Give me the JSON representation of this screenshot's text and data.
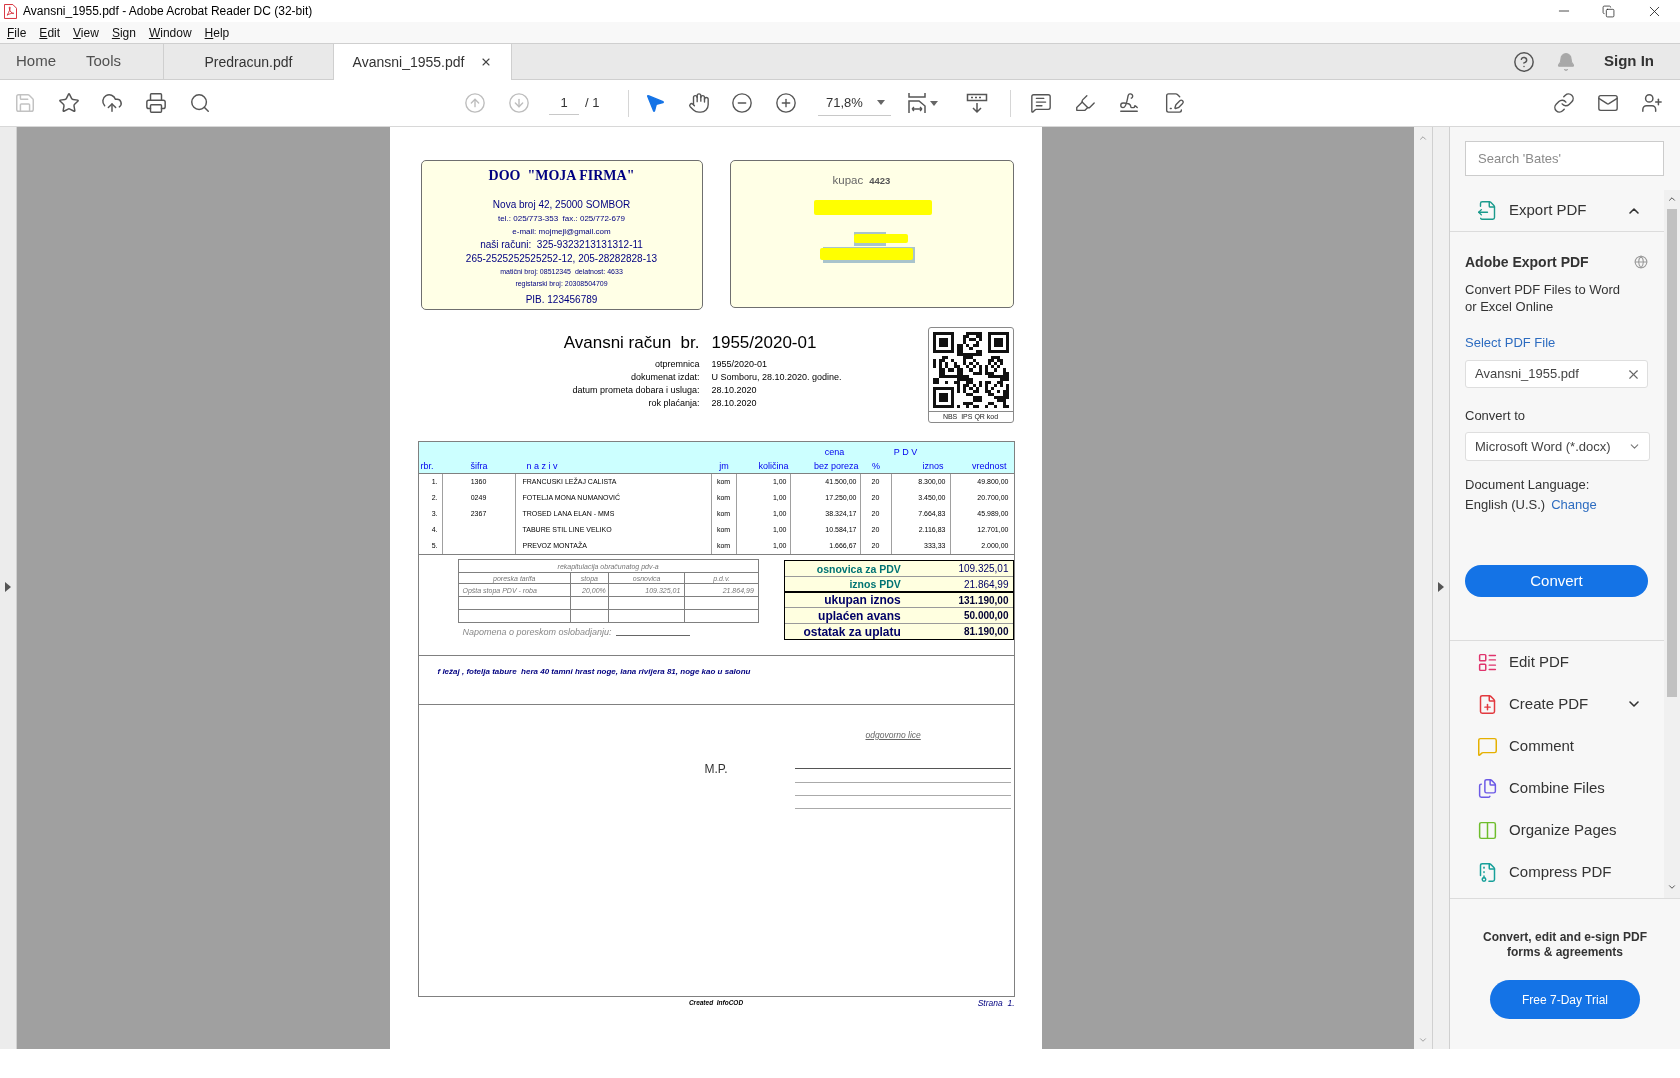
{
  "window": {
    "title": "Avansni_1955.pdf - Adobe Acrobat Reader DC (32-bit)"
  },
  "menu": [
    "File",
    "Edit",
    "View",
    "Sign",
    "Window",
    "Help"
  ],
  "nav": [
    "Home",
    "Tools"
  ],
  "tabs": [
    {
      "label": "Predracun.pdf",
      "selected": false
    },
    {
      "label": "Avansni_1955.pdf",
      "selected": true
    }
  ],
  "account": {
    "sign_in": "Sign In"
  },
  "toolbar": {
    "file_tools": [
      {
        "kind": "save",
        "disabled": true
      },
      {
        "kind": "bookmark",
        "disabled": false
      },
      {
        "kind": "upload",
        "disabled": false
      },
      {
        "kind": "print",
        "disabled": false
      },
      {
        "kind": "find",
        "disabled": false
      }
    ],
    "page_nav": [
      {
        "kind": "previous",
        "disabled": true
      },
      {
        "kind": "next",
        "disabled": true
      }
    ],
    "page": "1",
    "page_count": "/ 1",
    "pointer_tools": [
      {
        "kind": "select",
        "selected": true
      },
      {
        "kind": "hand",
        "selected": false
      }
    ],
    "zoom": "71,8%"
  },
  "document": {
    "seller": {
      "name": "DOO  \"MOJA FIRMA\"",
      "lines": [
        {
          "text": "Nova broj 42, 25000 SOMBOR",
          "kind": "large"
        },
        {
          "text": "tel.: 025/773-353  fax.: 025/772-679",
          "kind": "small"
        },
        {
          "text": "e-mail: mojmejl@gmail.com",
          "kind": "small"
        },
        {
          "text": "naši računi:  325-9323213131312-11",
          "kind": "large"
        },
        {
          "text": "265-2525252525252-12, 205-28282828-13",
          "kind": "large"
        },
        {
          "text": "matični broj: 08512345  delatnost: 4633",
          "kind": "tiny"
        },
        {
          "text": "registarski broj: 20308504709",
          "kind": "tiny"
        },
        {
          "text": "PIB. 123456789",
          "kind": "large"
        }
      ]
    },
    "buyer": {
      "label": "kupac",
      "code": "4423",
      "redactions": [
        {
          "highlighted": false
        },
        {
          "highlighted": true
        },
        {
          "highlighted": true
        }
      ]
    },
    "title": {
      "label": "Avansni račun  br.",
      "number": "1955/2020-01"
    },
    "details": [
      {
        "label": "otpremnica",
        "value": "1955/2020-01"
      },
      {
        "label": "dokumenat izdat:",
        "value": "U Somboru, 28.10.2020. godine."
      },
      {
        "label": "datum prometa dobara i usluga:",
        "value": "28.10.2020"
      },
      {
        "label": "rok plaćanja:",
        "value": "28.10.2020"
      }
    ],
    "qr": {
      "caption": "NBS  IPS QR kod"
    },
    "items": {
      "group_headings": [
        "cena",
        "P D V"
      ],
      "columns": [
        "rbr.",
        "šifra",
        "n a z i v",
        "jm",
        "količina",
        "bez poreza",
        "%",
        "iznos",
        "vrednost"
      ],
      "rows": [
        {
          "no": "1.",
          "code": "1360",
          "name": "FRANCUSKI LEŽAJ CALISTA",
          "unit": "kom",
          "qty": "1,00",
          "price": "41.500,00",
          "vat_rate": "20",
          "vat": "8.300,00",
          "total": "49.800,00"
        },
        {
          "no": "2.",
          "code": "0249",
          "name": "FOTELJA MONA NUMANOVIĆ",
          "unit": "kom",
          "qty": "1,00",
          "price": "17.250,00",
          "vat_rate": "20",
          "vat": "3.450,00",
          "total": "20.700,00"
        },
        {
          "no": "3.",
          "code": "2367",
          "name": "TROSED LANA ELAN - MMS",
          "unit": "kom",
          "qty": "1,00",
          "price": "38.324,17",
          "vat_rate": "20",
          "vat": "7.664,83",
          "total": "45.989,00"
        },
        {
          "no": "4.",
          "name": "TABURE STIL LINE VELIKO",
          "unit": "kom",
          "qty": "1,00",
          "price": "10.584,17",
          "vat_rate": "20",
          "vat": "2.116,83",
          "total": "12.701,00"
        },
        {
          "no": "5.",
          "name": "PREVOZ MONTAŽA",
          "unit": "kom",
          "qty": "1,00",
          "price": "1.666,67",
          "vat_rate": "20",
          "vat": "333,33",
          "total": "2.000,00"
        }
      ]
    },
    "vat_recap": {
      "title": "rekapitulacija obračunatog pdv-a",
      "columns": [
        "poreska tarifa",
        "stopa",
        "osnovica",
        "p.d.v."
      ],
      "rows": [
        [
          "Opšta stopa PDV - roba",
          "20,00%",
          "109.325,01",
          "21.864,99"
        ]
      ],
      "note": "Napomena o poreskom oslobadjanju:"
    },
    "totals": [
      {
        "label": "osnovica za PDV",
        "value": "109.325,01",
        "kind": "subtotal"
      },
      {
        "label": "iznos PDV",
        "value": "21.864,99",
        "kind": "subtotal"
      },
      {
        "label": "ukupan iznos",
        "value": "131.190,00",
        "kind": "total"
      },
      {
        "label": "uplaćen avans",
        "value": "50.000,00",
        "kind": "total"
      },
      {
        "label": "ostatak za uplatu",
        "value": "81.190,00",
        "kind": "total"
      }
    ],
    "remark": "f ležaj , fotelja tabure  hera 40 tamni hrast noge, lana rivijera 81, noge kao u salonu",
    "signature": {
      "label": "odgovorno lice",
      "stamp": "M.P."
    },
    "footer": {
      "credit": "Created  InfoCOD",
      "page": "Strana  1."
    }
  },
  "tools_panel": {
    "search": {
      "placeholder": "Search 'Bates'"
    },
    "export": {
      "title": "Export PDF",
      "expanded": true,
      "heading": "Adobe Export PDF",
      "description": "Convert PDF Files to Word or Excel Online",
      "select_label": "Select PDF File",
      "file": "Avansni_1955.pdf",
      "convert_to_label": "Convert to",
      "format": "Microsoft Word (*.docx)",
      "language_label": "Document Language:",
      "language": "English (U.S.)",
      "change_link": "Change",
      "button": "Convert"
    },
    "tools": [
      {
        "label": "Edit PDF",
        "kind": "edit",
        "expandable": false
      },
      {
        "label": "Create PDF",
        "kind": "create",
        "expandable": true
      },
      {
        "label": "Comment",
        "kind": "comment",
        "expandable": false
      },
      {
        "label": "Combine Files",
        "kind": "combine",
        "expandable": false
      },
      {
        "label": "Organize Pages",
        "kind": "organize",
        "expandable": false
      },
      {
        "label": "Compress PDF",
        "kind": "compress",
        "expandable": false
      }
    ],
    "promo": {
      "text": "Convert, edit and e-sign PDF forms & agreements",
      "button": "Free 7-Day Trial"
    }
  }
}
